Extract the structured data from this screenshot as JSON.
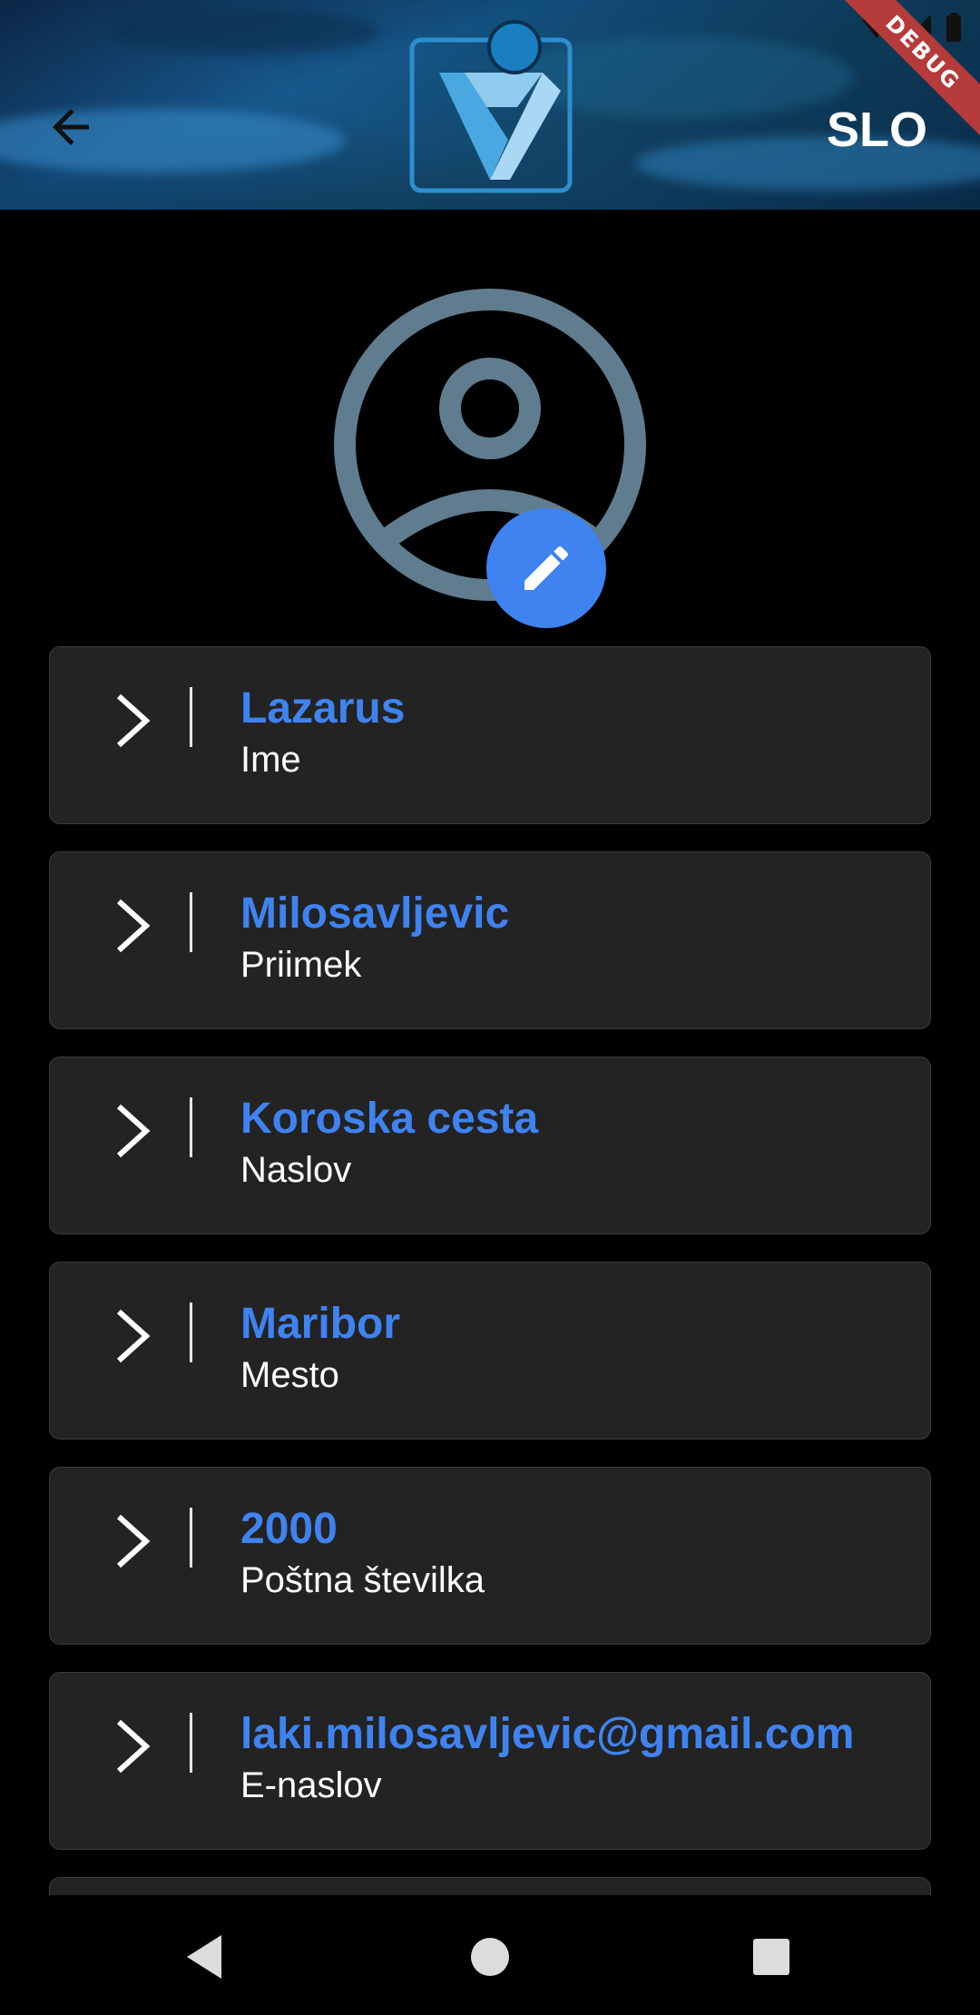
{
  "header": {
    "back_icon": "arrow-left-icon",
    "logo_icon": "v-badge-logo",
    "language_label": "SLO",
    "debug_banner": "DEBUG"
  },
  "profile": {
    "avatar_icon": "account-circle-icon",
    "edit_icon": "pencil-icon",
    "fields": [
      {
        "value": "Lazarus",
        "label": "Ime"
      },
      {
        "value": "Milosavljevic",
        "label": "Priimek"
      },
      {
        "value": "Koroska cesta",
        "label": "Naslov"
      },
      {
        "value": "Maribor",
        "label": "Mesto"
      },
      {
        "value": "2000",
        "label": "Poštna številka"
      },
      {
        "value": "laki.milosavljevic@gmail.com",
        "label": "E-naslov"
      }
    ]
  },
  "colors": {
    "accent": "#3f83f0",
    "card_bg": "#232323",
    "avatar": "#5f7d8e",
    "background": "#000000"
  },
  "nav": {
    "back_icon": "triangle-back-icon",
    "home_icon": "circle-home-icon",
    "recents_icon": "square-recents-icon"
  }
}
